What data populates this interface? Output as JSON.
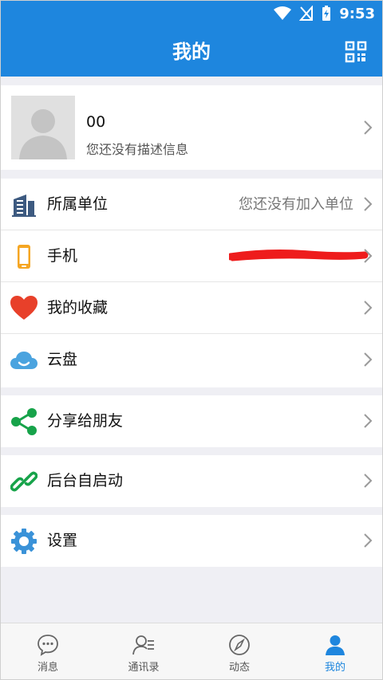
{
  "status_bar": {
    "time": "9:53"
  },
  "header": {
    "title": "我的",
    "qr_icon": "qr-code-icon"
  },
  "profile": {
    "name": "00",
    "description": "您还没有描述信息"
  },
  "menu": {
    "unit": {
      "label": "所属单位",
      "value": "您还没有加入单位",
      "icon": "building-icon"
    },
    "phone": {
      "label": "手机",
      "value_redacted": true,
      "icon": "phone-icon"
    },
    "favorites": {
      "label": "我的收藏",
      "icon": "heart-icon"
    },
    "cloud": {
      "label": "云盘",
      "icon": "cloud-icon"
    },
    "share": {
      "label": "分享给朋友",
      "icon": "share-icon"
    },
    "autostart": {
      "label": "后台自启动",
      "icon": "link-icon"
    },
    "settings": {
      "label": "设置",
      "icon": "gear-icon"
    }
  },
  "tabs": [
    {
      "label": "消息",
      "icon": "chat-bubble-icon",
      "active": false
    },
    {
      "label": "通讯录",
      "icon": "contacts-icon",
      "active": false
    },
    {
      "label": "动态",
      "icon": "compass-icon",
      "active": false
    },
    {
      "label": "我的",
      "icon": "user-icon",
      "active": true
    }
  ],
  "colors": {
    "accent": "#1e86de",
    "background": "#efeff4",
    "heart": "#e8402a",
    "share": "#17a34a",
    "phone": "#f5a623"
  }
}
